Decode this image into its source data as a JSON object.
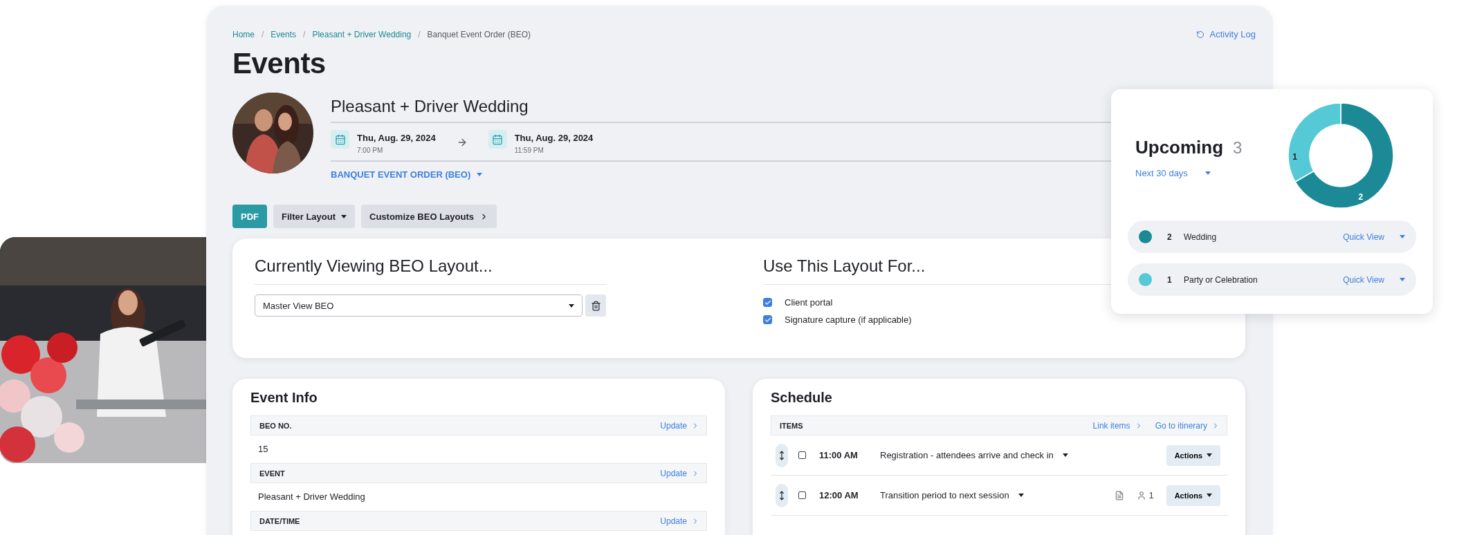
{
  "breadcrumb": [
    {
      "label": "Home",
      "current": false
    },
    {
      "separator": "/",
      "label": "Events",
      "current": false
    },
    {
      "separator": "/",
      "label": "Pleasant + Driver Wedding",
      "current": false
    },
    {
      "separator": "/",
      "label": "Banquet Event Order (BEO)",
      "current": true
    }
  ],
  "activity_log": "Activity Log",
  "page_title": "Events",
  "event": {
    "name": "Pleasant + Driver Wedding",
    "start": {
      "date": "Thu, Aug. 29, 2024",
      "time": "7:00 PM"
    },
    "end": {
      "date": "Thu, Aug. 29, 2024",
      "time": "11:59 PM"
    },
    "order_type": "BANQUET EVENT ORDER (BEO)"
  },
  "toolbar": [
    {
      "label": "PDF",
      "kind": "primary"
    },
    {
      "label": "Filter Layout",
      "kind": "dropdown"
    },
    {
      "label": "Customize BEO Layouts",
      "kind": "link"
    }
  ],
  "layout_card": {
    "title": "Currently Viewing BEO Layout...",
    "select_value": "Master View BEO",
    "usage_title": "Use This Layout For...",
    "options": [
      {
        "label": "Client portal",
        "checked": true
      },
      {
        "label": "Signature capture (if applicable)",
        "checked": true
      }
    ]
  },
  "event_info": {
    "title": "Event Info",
    "fields": [
      {
        "label": "BEO NO.",
        "action": "Update",
        "value": "15"
      },
      {
        "label": "EVENT",
        "action": "Update",
        "value": "Pleasant + Driver Wedding"
      },
      {
        "label": "DATE/TIME",
        "action": "Update"
      }
    ]
  },
  "schedule": {
    "title": "Schedule",
    "header": "ITEMS",
    "links": [
      "Link items",
      "Go to itinerary"
    ],
    "items": [
      {
        "time": "11:00 AM",
        "title": "Registration - attendees arrive and check in",
        "checked": false,
        "has_document": false,
        "actions": "Actions"
      },
      {
        "time": "12:00 AM",
        "title": "Transition period to next session",
        "checked": false,
        "has_document": true,
        "attendees": "1",
        "actions": "Actions"
      }
    ]
  },
  "upcoming": {
    "title": "Upcoming",
    "count": "3",
    "range": "Next 30 days",
    "chart_data": {
      "type": "donut",
      "categories": [
        "Wedding",
        "Party or Celebration"
      ],
      "values": [
        2,
        1
      ],
      "data_labels": true
    },
    "legend": [
      {
        "count": "2",
        "color": "#1b8a96",
        "action": "Quick View"
      },
      {
        "count": "1",
        "color": "#56c9d6",
        "action": "Quick View"
      }
    ]
  }
}
